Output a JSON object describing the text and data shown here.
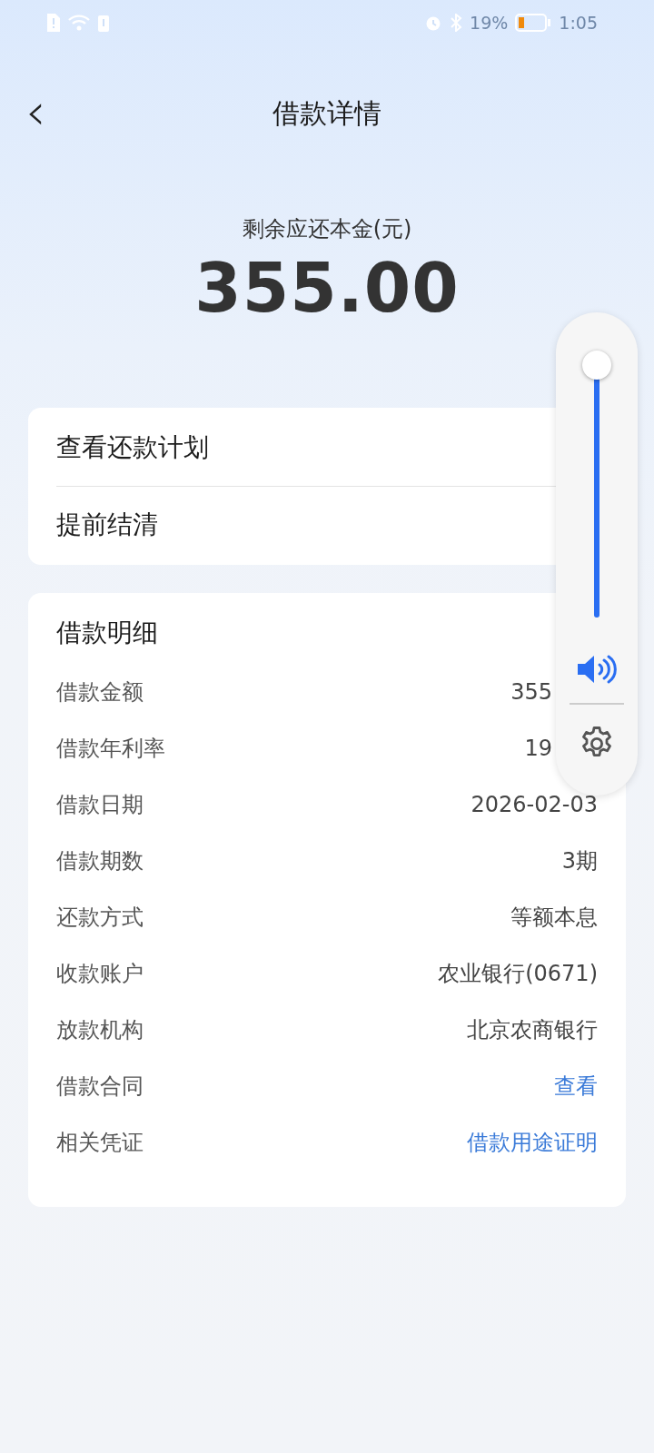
{
  "status_bar": {
    "battery_text": "19%",
    "time": "1:05"
  },
  "header": {
    "back": "‹",
    "title": "借款详情"
  },
  "summary": {
    "label": "剩余应还本金(元)",
    "amount": "355.00"
  },
  "actions": [
    {
      "label": "查看还款计划"
    },
    {
      "label": "提前结清"
    }
  ],
  "details": {
    "title": "借款明细",
    "rows": [
      {
        "label": "借款金额",
        "value": "355",
        "kind": "covered"
      },
      {
        "label": "借款年利率",
        "value": "19",
        "kind": "covered"
      },
      {
        "label": "借款日期",
        "value": "2026-02-03",
        "kind": "text"
      },
      {
        "label": "借款期数",
        "value": "3期",
        "kind": "text"
      },
      {
        "label": "还款方式",
        "value": "等额本息",
        "kind": "text"
      },
      {
        "label": "收款账户",
        "value": "农业银行(0671)",
        "kind": "text"
      },
      {
        "label": "放款机构",
        "value": "北京农商银行",
        "kind": "text"
      },
      {
        "label": "借款合同",
        "value": "查看",
        "kind": "link"
      },
      {
        "label": "相关凭证",
        "value": "借款用途证明",
        "kind": "link"
      }
    ]
  },
  "volume": {
    "level": 1.0
  }
}
